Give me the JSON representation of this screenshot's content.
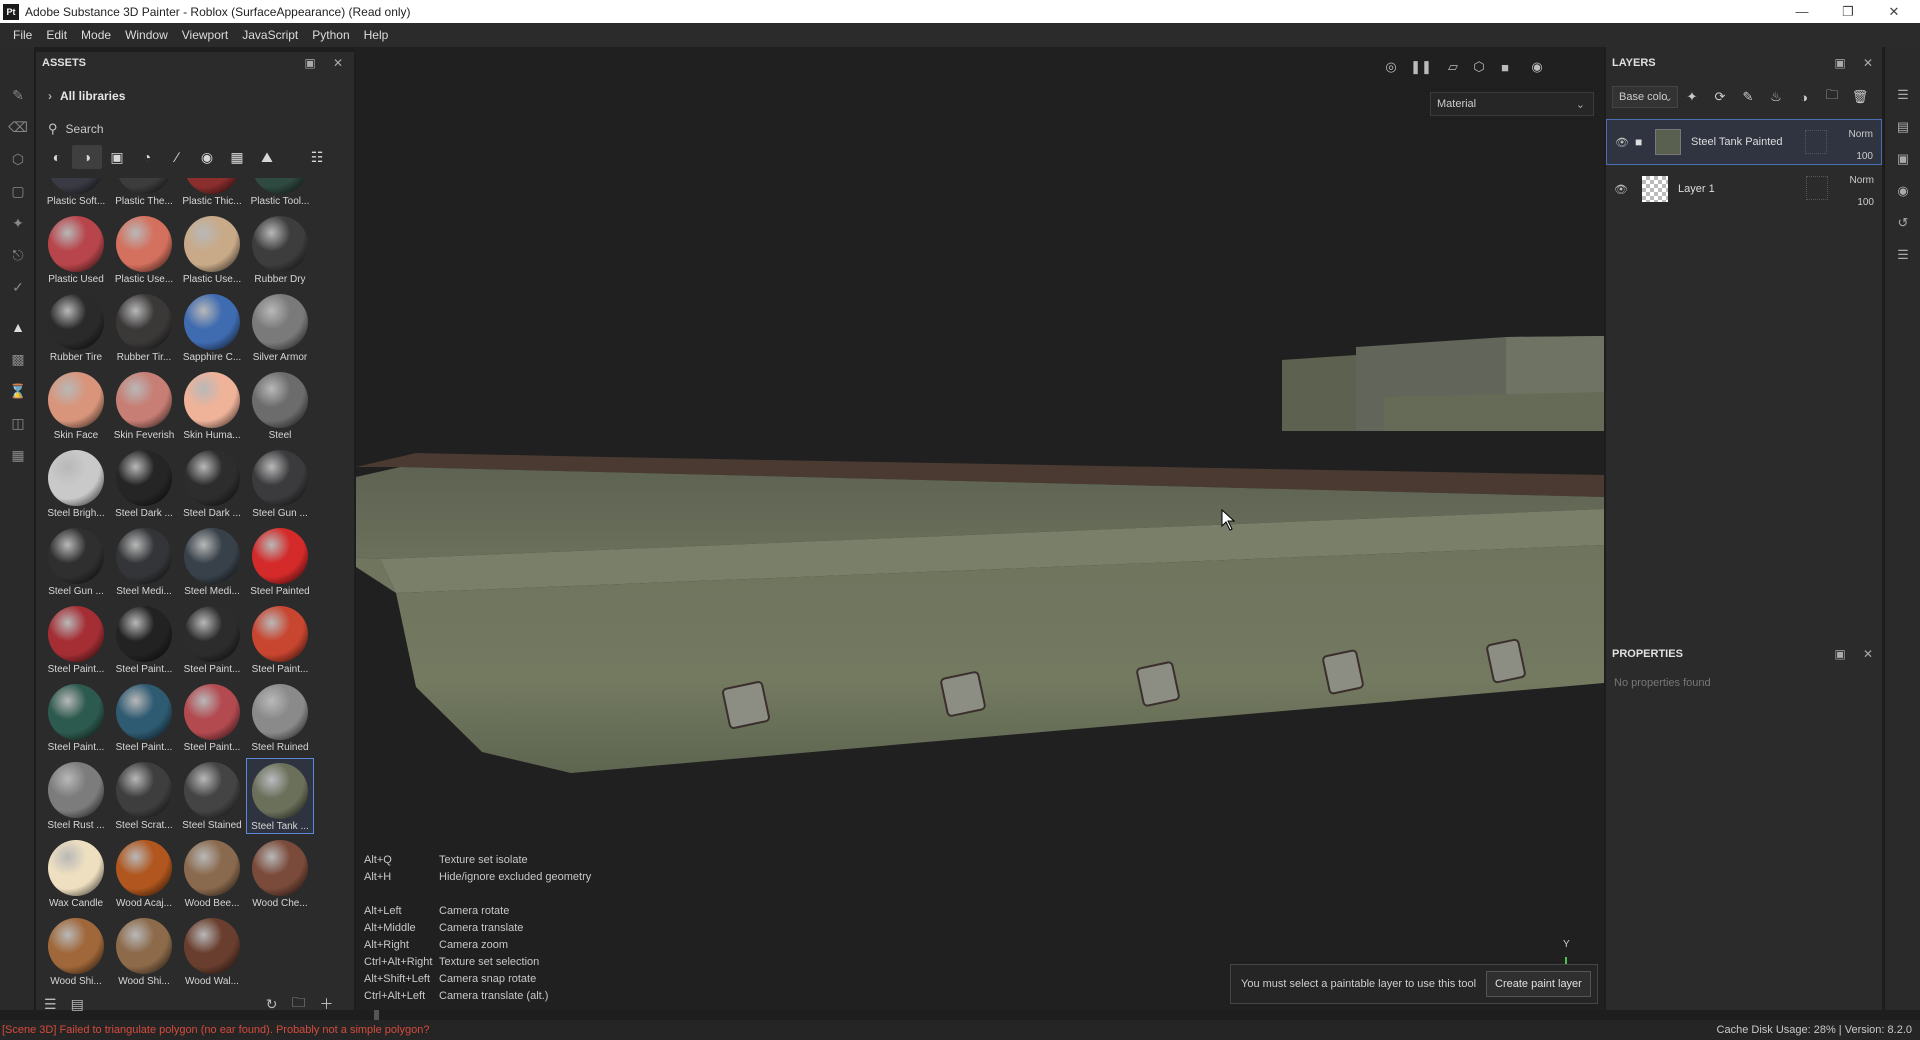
{
  "window": {
    "title": "Adobe Substance 3D Painter - Roblox (SurfaceAppearance) (Read only)",
    "logo": "Pt"
  },
  "menu": [
    "File",
    "Edit",
    "Mode",
    "Window",
    "Viewport",
    "JavaScript",
    "Python",
    "Help"
  ],
  "assets": {
    "title": "ASSETS",
    "libraries": "All libraries",
    "search_placeholder": "Search",
    "materials": [
      {
        "name": "Plastic Soft...",
        "color": "#3a3a44"
      },
      {
        "name": "Plastic The...",
        "color": "#3c3c3c"
      },
      {
        "name": "Plastic Thic...",
        "color": "#8a2e2e"
      },
      {
        "name": "Plastic Tool...",
        "color": "#2f4a40"
      },
      {
        "name": "Plastic Used",
        "color": "#b8454b"
      },
      {
        "name": "Plastic Use...",
        "color": "#d4705e"
      },
      {
        "name": "Plastic Use...",
        "color": "#c8aa88"
      },
      {
        "name": "Rubber Dry",
        "color": "#3d3d3d"
      },
      {
        "name": "Rubber Tire",
        "color": "#2a2a2a"
      },
      {
        "name": "Rubber Tir...",
        "color": "#3b3838"
      },
      {
        "name": "Sapphire C...",
        "color": "#3f6bb0"
      },
      {
        "name": "Silver Armor",
        "color": "#7a7a7a"
      },
      {
        "name": "Skin Face",
        "color": "#d8957b"
      },
      {
        "name": "Skin Feverish",
        "color": "#c77e74"
      },
      {
        "name": "Skin Huma...",
        "color": "#efb39a"
      },
      {
        "name": "Steel",
        "color": "#6c6c6c"
      },
      {
        "name": "Steel Brigh...",
        "color": "#c9c9c9"
      },
      {
        "name": "Steel Dark ...",
        "color": "#252525"
      },
      {
        "name": "Steel Dark ...",
        "color": "#2d2d2d"
      },
      {
        "name": "Steel Gun ...",
        "color": "#3b3b3e"
      },
      {
        "name": "Steel Gun ...",
        "color": "#2f2f2f"
      },
      {
        "name": "Steel Medi...",
        "color": "#333538"
      },
      {
        "name": "Steel Medi...",
        "color": "#38414a"
      },
      {
        "name": "Steel Painted",
        "color": "#d42a2a"
      },
      {
        "name": "Steel Paint...",
        "color": "#a42e34"
      },
      {
        "name": "Steel Paint...",
        "color": "#222222"
      },
      {
        "name": "Steel Paint...",
        "color": "#2c2c2c"
      },
      {
        "name": "Steel Paint...",
        "color": "#c8452f"
      },
      {
        "name": "Steel Paint...",
        "color": "#2d5a4e"
      },
      {
        "name": "Steel Paint...",
        "color": "#2e5a72"
      },
      {
        "name": "Steel Paint...",
        "color": "#b24a50"
      },
      {
        "name": "Steel Ruined",
        "color": "#8a8a8a"
      },
      {
        "name": "Steel Rust ...",
        "color": "#7c7c7c"
      },
      {
        "name": "Steel Scrat...",
        "color": "#3e3e3e"
      },
      {
        "name": "Steel Stained",
        "color": "#444444"
      },
      {
        "name": "Steel Tank ...",
        "color": "#6a705a"
      },
      {
        "name": "Wax Candle",
        "color": "#eedfc0"
      },
      {
        "name": "Wood Acaj...",
        "color": "#b0561e"
      },
      {
        "name": "Wood Bee...",
        "color": "#8a6a4e"
      },
      {
        "name": "Wood Che...",
        "color": "#7a4a3a"
      },
      {
        "name": "Wood Shi...",
        "color": "#a0683a"
      },
      {
        "name": "Wood Shi...",
        "color": "#8c6a4a"
      },
      {
        "name": "Wood Wal...",
        "color": "#6a3e2e"
      }
    ],
    "selected_index": 35
  },
  "viewport": {
    "mode_select": "Material",
    "shortcuts": [
      {
        "key": "Alt+Q",
        "action": "Texture set isolate"
      },
      {
        "key": "Alt+H",
        "action": "Hide/ignore excluded geometry"
      },
      {
        "key": "",
        "action": ""
      },
      {
        "key": "Alt+Left",
        "action": "Camera rotate"
      },
      {
        "key": "Alt+Middle",
        "action": "Camera translate"
      },
      {
        "key": "Alt+Right",
        "action": "Camera zoom"
      },
      {
        "key": "Ctrl+Alt+Right",
        "action": "Texture set selection"
      },
      {
        "key": "Alt+Shift+Left",
        "action": "Camera snap rotate"
      },
      {
        "key": "Ctrl+Alt+Left",
        "action": "Camera translate (alt.)"
      }
    ],
    "toast": {
      "message": "You must select a paintable layer to use this tool",
      "button": "Create paint layer"
    },
    "axis_label": "Y"
  },
  "layers": {
    "title": "LAYERS",
    "channel": "Base colo",
    "items": [
      {
        "name": "Steel Tank Painted",
        "blend": "Norm",
        "opacity": "100",
        "selected": true
      },
      {
        "name": "Layer 1",
        "blend": "Norm",
        "opacity": "100",
        "selected": false
      }
    ]
  },
  "properties": {
    "title": "PROPERTIES",
    "empty": "No properties found"
  },
  "status": {
    "error": "[Scene 3D] Failed to triangulate polygon (no ear found). Probably not a simple polygon?",
    "cache": "Cache Disk Usage:   28% | Version: 8.2.0"
  }
}
